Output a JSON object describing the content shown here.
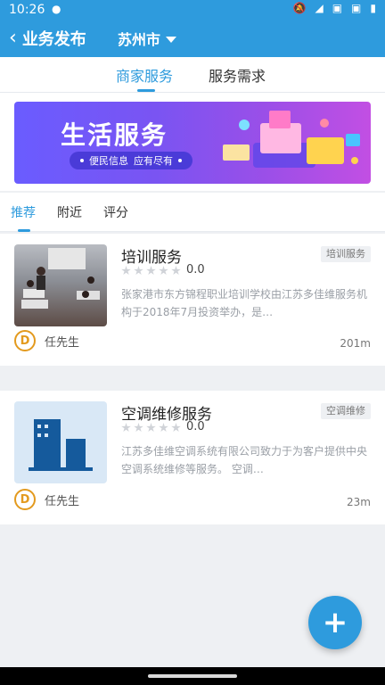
{
  "status_bar": {
    "time": "10:26"
  },
  "header": {
    "back_title": "业务发布",
    "city": "苏州市"
  },
  "main_tabs": [
    {
      "label": "商家服务",
      "active": true
    },
    {
      "label": "服务需求",
      "active": false
    }
  ],
  "banner": {
    "title": "生活服务",
    "tagline_1": "便民信息",
    "tagline_2": "应有尽有"
  },
  "filter_tabs": [
    {
      "label": "推荐",
      "active": true
    },
    {
      "label": "附近",
      "active": false
    },
    {
      "label": "评分",
      "active": false
    }
  ],
  "listings": [
    {
      "title": "培训服务",
      "category": "培训服务",
      "rating": "0.0",
      "description": "张家港市东方锦程职业培训学校由江苏多佳维服务机构于2018年7月投资举办，是…",
      "owner": "任先生",
      "distance": "201m",
      "thumbnail": "classroom-photo"
    },
    {
      "title": "空调维修服务",
      "category": "空调维修",
      "rating": "0.0",
      "description": "江苏多佳维空调系统有限公司致力于为客户提供中央空调系统维修等服务。 空调…",
      "owner": "任先生",
      "distance": "23m",
      "thumbnail": "building-icon"
    }
  ],
  "colors": {
    "accent": "#2e9bdd",
    "banner_start": "#6a5cff",
    "banner_end": "#c24fe3"
  },
  "icons": {
    "back": "chevron-left-icon",
    "city_dropdown": "caret-down-icon",
    "fab": "plus-icon",
    "owner_avatar": "logo-badge-icon"
  }
}
